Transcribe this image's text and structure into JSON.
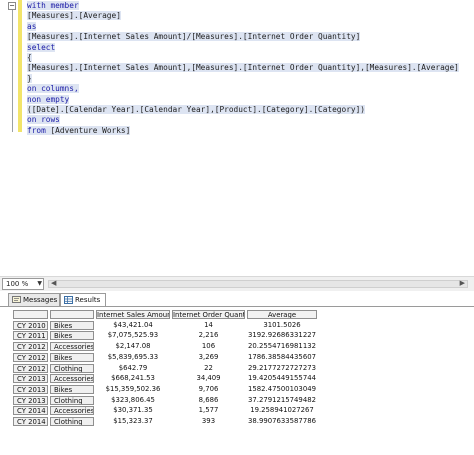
{
  "editor": {
    "lines": [
      [
        {
          "t": "with member",
          "k": "kw"
        }
      ],
      [
        {
          "t": "[Measures].[Average]",
          "k": "tx"
        }
      ],
      [
        {
          "t": "as",
          "k": "kw"
        }
      ],
      [
        {
          "t": "[Measures].[Internet Sales Amount]/[Measures].[Internet Order Quantity]",
          "k": "tx"
        }
      ],
      [
        {
          "t": "select",
          "k": "kw"
        }
      ],
      [
        {
          "t": "{",
          "k": "tx"
        }
      ],
      [
        {
          "t": "[Measures].[Internet Sales Amount],[Measures].[Internet Order Quantity],[Measures].[Average]",
          "k": "tx"
        }
      ],
      [
        {
          "t": "}",
          "k": "tx"
        }
      ],
      [
        {
          "t": "on columns,",
          "k": "kw"
        }
      ],
      [
        {
          "t": "non empty",
          "k": "kw"
        }
      ],
      [
        {
          "t": "([Date].[Calendar Year].[Calendar Year],[Product].[Category].[Category])",
          "k": "tx"
        }
      ],
      [
        {
          "t": "on rows",
          "k": "kw"
        }
      ],
      [
        {
          "t": "from ",
          "k": "kw"
        },
        {
          "t": "[Adventure Works]",
          "k": "tx"
        }
      ]
    ]
  },
  "zoom": {
    "value": "100 %"
  },
  "tabs": {
    "messages": "Messages",
    "results": "Results"
  },
  "grid": {
    "headers": [
      "Internet Sales Amount",
      "Internet Order Quantity",
      "Average"
    ],
    "rows": [
      [
        "CY 2010",
        "Bikes",
        "$43,421.04",
        "14",
        "3101.5026"
      ],
      [
        "CY 2011",
        "Bikes",
        "$7,075,525.93",
        "2,216",
        "3192.92686331227"
      ],
      [
        "CY 2012",
        "Accessories",
        "$2,147.08",
        "106",
        "20.2554716981132"
      ],
      [
        "CY 2012",
        "Bikes",
        "$5,839,695.33",
        "3,269",
        "1786.38584435607"
      ],
      [
        "CY 2012",
        "Clothing",
        "$642.79",
        "22",
        "29.2177272727273"
      ],
      [
        "CY 2013",
        "Accessories",
        "$668,241.53",
        "34,409",
        "19.4205449155744"
      ],
      [
        "CY 2013",
        "Bikes",
        "$15,359,502.36",
        "9,706",
        "1582.47500103049"
      ],
      [
        "CY 2013",
        "Clothing",
        "$323,806.45",
        "8,686",
        "37.2791215749482"
      ],
      [
        "CY 2014",
        "Accessories",
        "$30,371.35",
        "1,577",
        "19.258941027267"
      ],
      [
        "CY 2014",
        "Clothing",
        "$15,323.37",
        "393",
        "38.9907633587786"
      ]
    ]
  }
}
